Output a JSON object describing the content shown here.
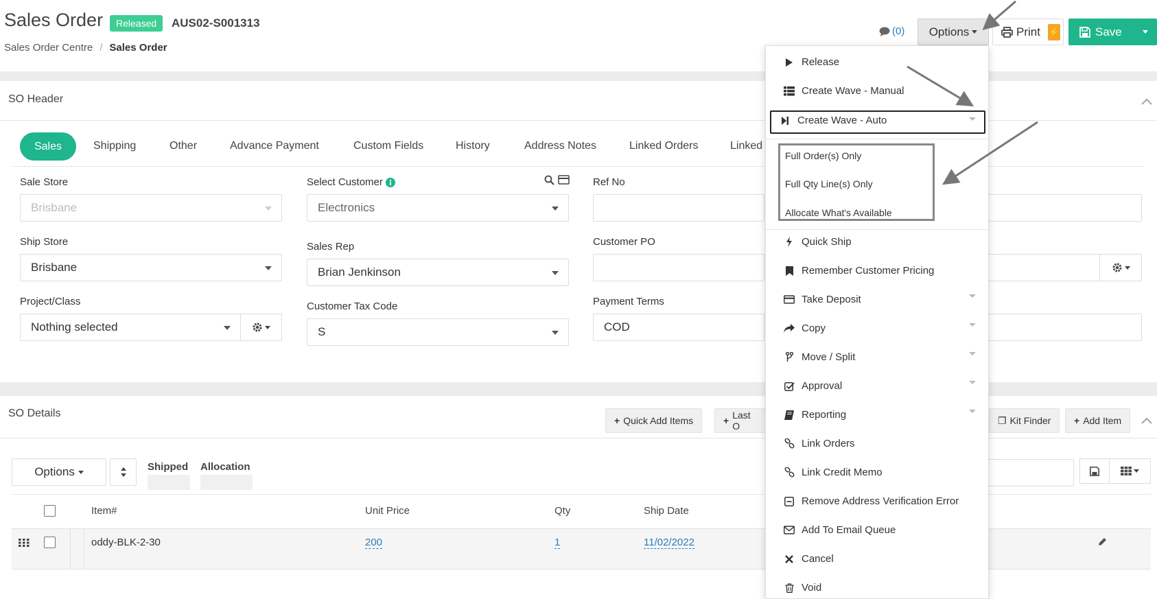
{
  "header": {
    "title": "Sales Order",
    "status_badge": "Released",
    "order_number": "AUS02-S001313",
    "breadcrumb": {
      "parent": "Sales Order Centre",
      "separator": "/",
      "current": "Sales Order"
    },
    "comments_count": "(0)",
    "options_label": "Options",
    "print_label": "Print",
    "save_label": "Save"
  },
  "so_header": {
    "title": "SO Header",
    "tabs": [
      {
        "label": "Sales",
        "active": true
      },
      {
        "label": "Shipping"
      },
      {
        "label": "Other"
      },
      {
        "label": "Advance Payment"
      },
      {
        "label": "Custom Fields"
      },
      {
        "label": "History"
      },
      {
        "label": "Address Notes"
      },
      {
        "label": "Linked Orders"
      },
      {
        "label": "Linked"
      }
    ],
    "fields": {
      "sale_store": {
        "label": "Sale Store",
        "value": "Brisbane"
      },
      "select_customer": {
        "label": "Select Customer",
        "value": "Electronics"
      },
      "ref_no": {
        "label": "Ref No",
        "value": ""
      },
      "ship_store": {
        "label": "Ship Store",
        "value": "Brisbane"
      },
      "sales_rep": {
        "label": "Sales Rep",
        "value": "Brian Jenkinson"
      },
      "customer_po": {
        "label": "Customer PO",
        "value": ""
      },
      "project_class": {
        "label": "Project/Class",
        "value": "Nothing selected"
      },
      "customer_tax_code": {
        "label": "Customer Tax Code",
        "value": "S"
      },
      "payment_terms": {
        "label": "Payment Terms",
        "value": "COD"
      }
    }
  },
  "so_details": {
    "title": "SO Details",
    "toolbar": {
      "quick_add": "Quick Add Items",
      "last_order": "Last O",
      "kit_finder": "Kit Finder",
      "add_item": "Add Item"
    },
    "options_label": "Options",
    "filters": {
      "shipped": "Shipped",
      "allocation": "Allocation"
    },
    "columns": [
      "Item#",
      "Unit Price",
      "Qty",
      "Ship Date"
    ],
    "rows": [
      {
        "item": "oddy-BLK-2-30",
        "unit_price": "200",
        "qty": "1",
        "ship_date": "11/02/2022"
      }
    ]
  },
  "options_menu": {
    "items": [
      {
        "label": "Release",
        "icon": "play-icon"
      },
      {
        "label": "Create Wave - Manual",
        "icon": "list-icon"
      },
      {
        "label": "Create Wave - Auto",
        "icon": "step-forward-icon",
        "expanded": true
      },
      {
        "label": "Quick Ship",
        "icon": "bolt-icon"
      },
      {
        "label": "Remember Customer Pricing",
        "icon": "bookmark-icon"
      },
      {
        "label": "Take Deposit",
        "icon": "credit-card-icon"
      },
      {
        "label": "Copy",
        "icon": "share-icon"
      },
      {
        "label": "Move / Split",
        "icon": "branch-icon"
      },
      {
        "label": "Approval",
        "icon": "check-square-icon"
      },
      {
        "label": "Reporting",
        "icon": "book-icon"
      },
      {
        "label": "Link Orders",
        "icon": "link-icon"
      },
      {
        "label": "Link Credit Memo",
        "icon": "link-icon"
      },
      {
        "label": "Remove Address Verification Error",
        "icon": "minus-square-icon"
      },
      {
        "label": "Add To Email Queue",
        "icon": "envelope-icon"
      },
      {
        "label": "Cancel",
        "icon": "times-icon"
      },
      {
        "label": "Void",
        "icon": "trash-icon"
      }
    ],
    "submenu": [
      "Full Order(s) Only",
      "Full Qty Line(s) Only",
      "Allocate What's Available"
    ]
  },
  "colors": {
    "accent": "#1fb58d",
    "badge": "#3dce94",
    "link": "#2a7bb8",
    "bolt": "#f5a623"
  }
}
